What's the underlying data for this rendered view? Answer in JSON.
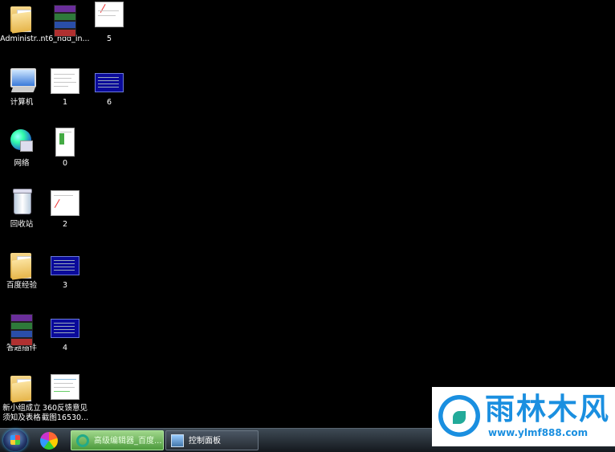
{
  "desktop": {
    "icons": [
      {
        "label": "Administr..."
      },
      {
        "label": "nt6_hdd_in..."
      },
      {
        "label": "5"
      },
      {
        "label": "计算机"
      },
      {
        "label": "1"
      },
      {
        "label": "6"
      },
      {
        "label": "网络"
      },
      {
        "label": "0"
      },
      {
        "label": "回收站"
      },
      {
        "label": "2"
      },
      {
        "label": "百度经验"
      },
      {
        "label": "3"
      },
      {
        "label": "答题插件"
      },
      {
        "label": "4"
      },
      {
        "label": "新小组成立\n须知及表格"
      },
      {
        "label": "360反馈意见\n截图16530..."
      }
    ]
  },
  "taskbar": {
    "buttons": [
      {
        "label": "高级编辑器_百度..."
      },
      {
        "label": "控制面板"
      }
    ]
  },
  "watermark": {
    "brand": "雨林木风",
    "url": "www.ylmf888.com",
    "color": "#1a8fe0"
  }
}
